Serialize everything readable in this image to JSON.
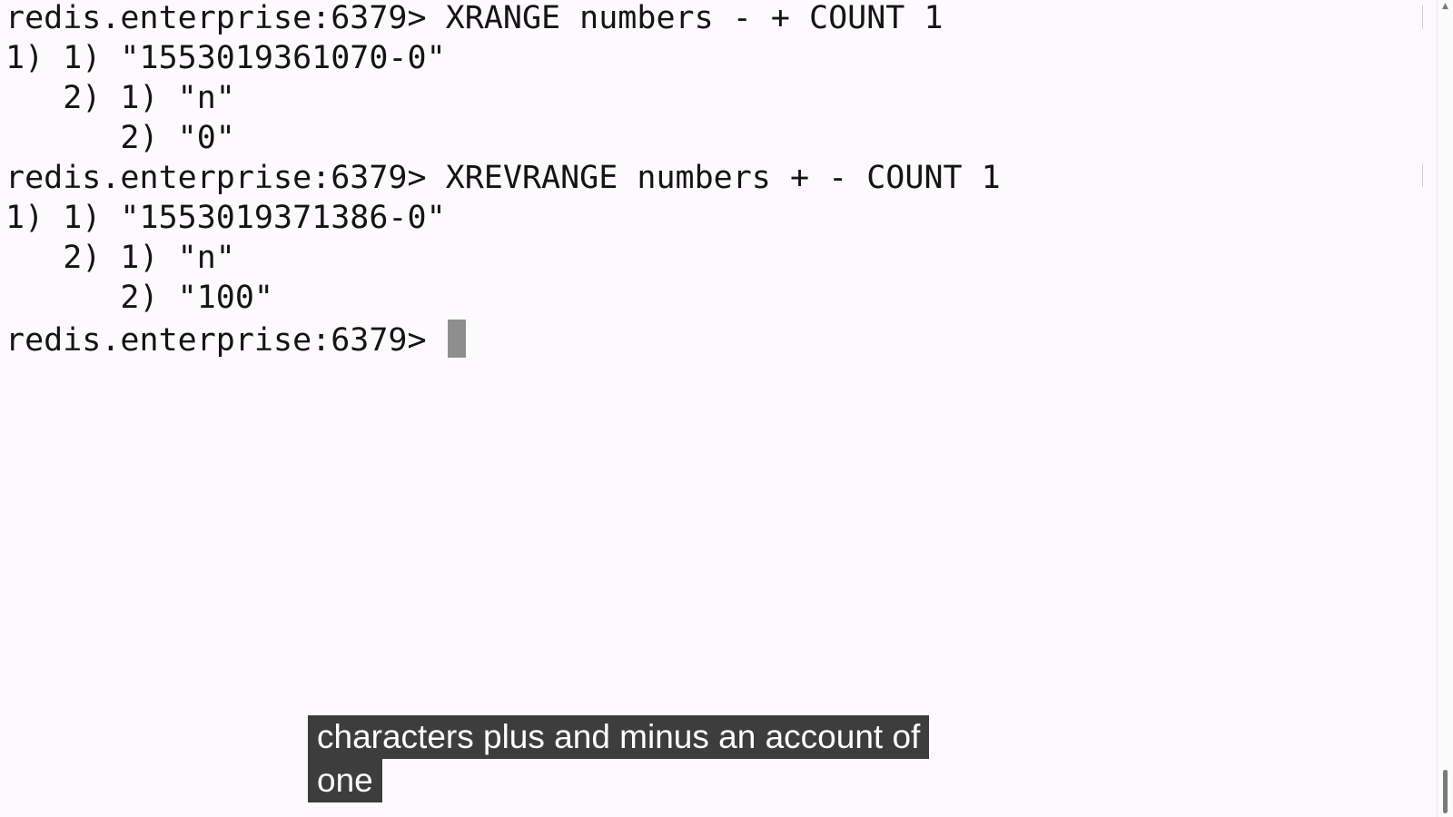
{
  "terminal": {
    "prompt": "redis.enterprise:6379> ",
    "lines": [
      "redis.enterprise:6379> XRANGE numbers - + COUNT 1",
      "1) 1) \"1553019361070-0\"",
      "   2) 1) \"n\"",
      "      2) \"0\"",
      "redis.enterprise:6379> XREVRANGE numbers + - COUNT 1",
      "1) 1) \"1553019371386-0\"",
      "   2) 1) \"n\"",
      "      2) \"100\""
    ]
  },
  "captions": {
    "line1": "characters plus and minus an account of",
    "line2": "one"
  },
  "colors": {
    "background": "#fdfafd",
    "text": "#141414",
    "cursor": "#8e8e8e",
    "caption_bg": "#141414"
  },
  "scrollbar": {
    "up_icon": "scroll-up-arrow-icon"
  }
}
